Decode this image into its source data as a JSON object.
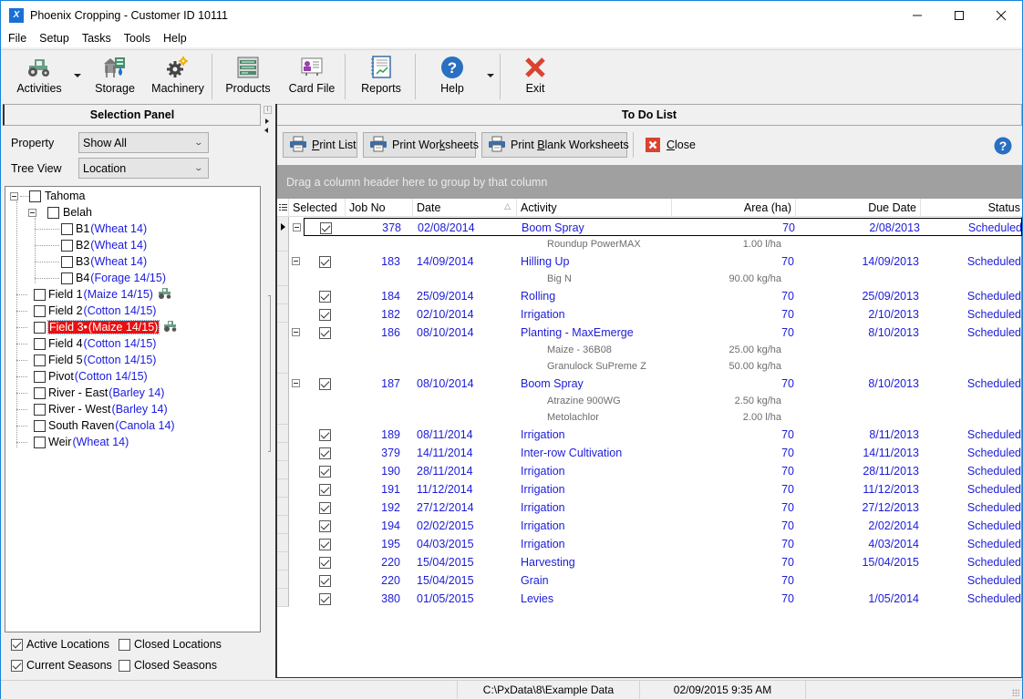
{
  "window": {
    "title": "Phoenix Cropping - Customer ID 10111",
    "controls": {
      "minimize": "—",
      "maximize": "☐",
      "close": "✕"
    }
  },
  "menu": [
    "File",
    "Setup",
    "Tasks",
    "Tools",
    "Help"
  ],
  "toolbar": {
    "activities": "Activities",
    "storage": "Storage",
    "machinery": "Machinery",
    "products": "Products",
    "card_file": "Card File",
    "reports": "Reports",
    "help": "Help",
    "exit": "Exit"
  },
  "selection_panel": {
    "title": "Selection Panel",
    "property_label": "Property",
    "property_value": "Show All",
    "tree_view_label": "Tree View",
    "tree_view_value": "Location",
    "tree": {
      "root": {
        "name": "Tahoma",
        "checked": false
      },
      "group": {
        "name": "Belah",
        "checked": false
      },
      "group_children": [
        {
          "name": "B1",
          "crop": "(Wheat 14)"
        },
        {
          "name": "B2",
          "crop": "(Wheat 14)"
        },
        {
          "name": "B3",
          "crop": "(Wheat 14)"
        },
        {
          "name": "B4",
          "crop": "(Forage 14/15)"
        }
      ],
      "fields": [
        {
          "name": "Field 1",
          "crop": "(Maize 14/15)",
          "tractor": true,
          "selected": false
        },
        {
          "name": "Field 2",
          "crop": "(Cotton 14/15)",
          "tractor": false,
          "selected": false
        },
        {
          "name": "Field 3•",
          "crop": "(Maize 14/15)",
          "tractor": true,
          "selected": true
        },
        {
          "name": "Field 4",
          "crop": "(Cotton 14/15)",
          "tractor": false,
          "selected": false
        },
        {
          "name": "Field 5",
          "crop": "(Cotton 14/15)",
          "tractor": false,
          "selected": false
        },
        {
          "name": "Pivot",
          "crop": "(Cotton 14/15)",
          "tractor": false,
          "selected": false
        },
        {
          "name": "River - East",
          "crop": "(Barley 14)",
          "tractor": false,
          "selected": false
        },
        {
          "name": "River - West",
          "crop": "(Barley 14)",
          "tractor": false,
          "selected": false
        },
        {
          "name": "South Raven",
          "crop": "(Canola 14)",
          "tractor": false,
          "selected": false
        },
        {
          "name": "Weir",
          "crop": "(Wheat 14)",
          "tractor": false,
          "selected": false
        }
      ]
    },
    "filters": {
      "active_locations": {
        "label": "Active Locations",
        "checked": true
      },
      "closed_locations": {
        "label": "Closed Locations",
        "checked": false
      },
      "current_seasons": {
        "label": "Current Seasons",
        "checked": true
      },
      "closed_seasons": {
        "label": "Closed Seasons",
        "checked": false
      }
    }
  },
  "todo": {
    "title": "To Do List",
    "buttons": {
      "print_list": {
        "pre": "",
        "u": "P",
        "post": "rint List"
      },
      "print_worksheets": {
        "pre": "Print Wor",
        "u": "k",
        "post": "sheets"
      },
      "print_blank": {
        "pre": "Print ",
        "u": "B",
        "post": "lank Worksheets"
      },
      "close": {
        "pre": "",
        "u": "C",
        "post": "lose"
      }
    },
    "group_hint": "Drag a column header here to group by that column",
    "columns": [
      "Selected",
      "Job No",
      "Date",
      "Activity",
      "Area (ha)",
      "Due Date",
      "Status"
    ],
    "sorted_column": "Date",
    "rows": [
      {
        "expandable": true,
        "selected": true,
        "job_no": "378",
        "date": "02/08/2014",
        "activity": "Boom Spray",
        "area": "70",
        "due_date": "2/08/2013",
        "status": "Scheduled",
        "current": true,
        "products": [
          {
            "name": "Roundup PowerMAX",
            "rate": "1.00 l/ha"
          }
        ]
      },
      {
        "expandable": true,
        "selected": true,
        "job_no": "183",
        "date": "14/09/2014",
        "activity": "Hilling Up",
        "area": "70",
        "due_date": "14/09/2013",
        "status": "Scheduled",
        "products": [
          {
            "name": "Big N",
            "rate": "90.00 kg/ha"
          }
        ]
      },
      {
        "expandable": false,
        "selected": true,
        "job_no": "184",
        "date": "25/09/2014",
        "activity": "Rolling",
        "area": "70",
        "due_date": "25/09/2013",
        "status": "Scheduled",
        "products": []
      },
      {
        "expandable": false,
        "selected": true,
        "job_no": "182",
        "date": "02/10/2014",
        "activity": "Irrigation",
        "area": "70",
        "due_date": "2/10/2013",
        "status": "Scheduled",
        "products": []
      },
      {
        "expandable": true,
        "selected": true,
        "job_no": "186",
        "date": "08/10/2014",
        "activity": "Planting - MaxEmerge",
        "area": "70",
        "due_date": "8/10/2013",
        "status": "Scheduled",
        "products": [
          {
            "name": "Maize - 36B08",
            "rate": "25.00 kg/ha"
          },
          {
            "name": "Granulock SuPreme Z",
            "rate": "50.00 kg/ha"
          }
        ]
      },
      {
        "expandable": true,
        "selected": true,
        "job_no": "187",
        "date": "08/10/2014",
        "activity": "Boom Spray",
        "area": "70",
        "due_date": "8/10/2013",
        "status": "Scheduled",
        "products": [
          {
            "name": "Atrazine 900WG",
            "rate": "2.50 kg/ha"
          },
          {
            "name": "Metolachlor",
            "rate": "2.00 l/ha"
          }
        ]
      },
      {
        "expandable": false,
        "selected": true,
        "job_no": "189",
        "date": "08/11/2014",
        "activity": "Irrigation",
        "area": "70",
        "due_date": "8/11/2013",
        "status": "Scheduled",
        "products": []
      },
      {
        "expandable": false,
        "selected": true,
        "job_no": "379",
        "date": "14/11/2014",
        "activity": "Inter-row Cultivation",
        "area": "70",
        "due_date": "14/11/2013",
        "status": "Scheduled",
        "products": []
      },
      {
        "expandable": false,
        "selected": true,
        "job_no": "190",
        "date": "28/11/2014",
        "activity": "Irrigation",
        "area": "70",
        "due_date": "28/11/2013",
        "status": "Scheduled",
        "products": []
      },
      {
        "expandable": false,
        "selected": true,
        "job_no": "191",
        "date": "11/12/2014",
        "activity": "Irrigation",
        "area": "70",
        "due_date": "11/12/2013",
        "status": "Scheduled",
        "products": []
      },
      {
        "expandable": false,
        "selected": true,
        "job_no": "192",
        "date": "27/12/2014",
        "activity": "Irrigation",
        "area": "70",
        "due_date": "27/12/2013",
        "status": "Scheduled",
        "products": []
      },
      {
        "expandable": false,
        "selected": true,
        "job_no": "194",
        "date": "02/02/2015",
        "activity": "Irrigation",
        "area": "70",
        "due_date": "2/02/2014",
        "status": "Scheduled",
        "products": []
      },
      {
        "expandable": false,
        "selected": true,
        "job_no": "195",
        "date": "04/03/2015",
        "activity": "Irrigation",
        "area": "70",
        "due_date": "4/03/2014",
        "status": "Scheduled",
        "products": []
      },
      {
        "expandable": false,
        "selected": true,
        "job_no": "220",
        "date": "15/04/2015",
        "activity": "Harvesting",
        "area": "70",
        "due_date": "15/04/2015",
        "status": "Scheduled",
        "products": []
      },
      {
        "expandable": false,
        "selected": true,
        "job_no": "220",
        "date": "15/04/2015",
        "activity": "Grain",
        "area": "70",
        "due_date": "",
        "status": "Scheduled",
        "products": []
      },
      {
        "expandable": false,
        "selected": true,
        "job_no": "380",
        "date": "01/05/2015",
        "activity": "Levies",
        "area": "70",
        "due_date": "1/05/2014",
        "status": "Scheduled",
        "products": []
      }
    ]
  },
  "statusbar": {
    "path": "C:\\PxData\\8\\Example Data",
    "datetime": "02/09/2015  9:35 AM"
  },
  "colors": {
    "accent": "#1883d7",
    "link_text": "#1c1cd8",
    "selected_tree_bg": "#e81010",
    "group_bar": "#a0a0a0"
  }
}
